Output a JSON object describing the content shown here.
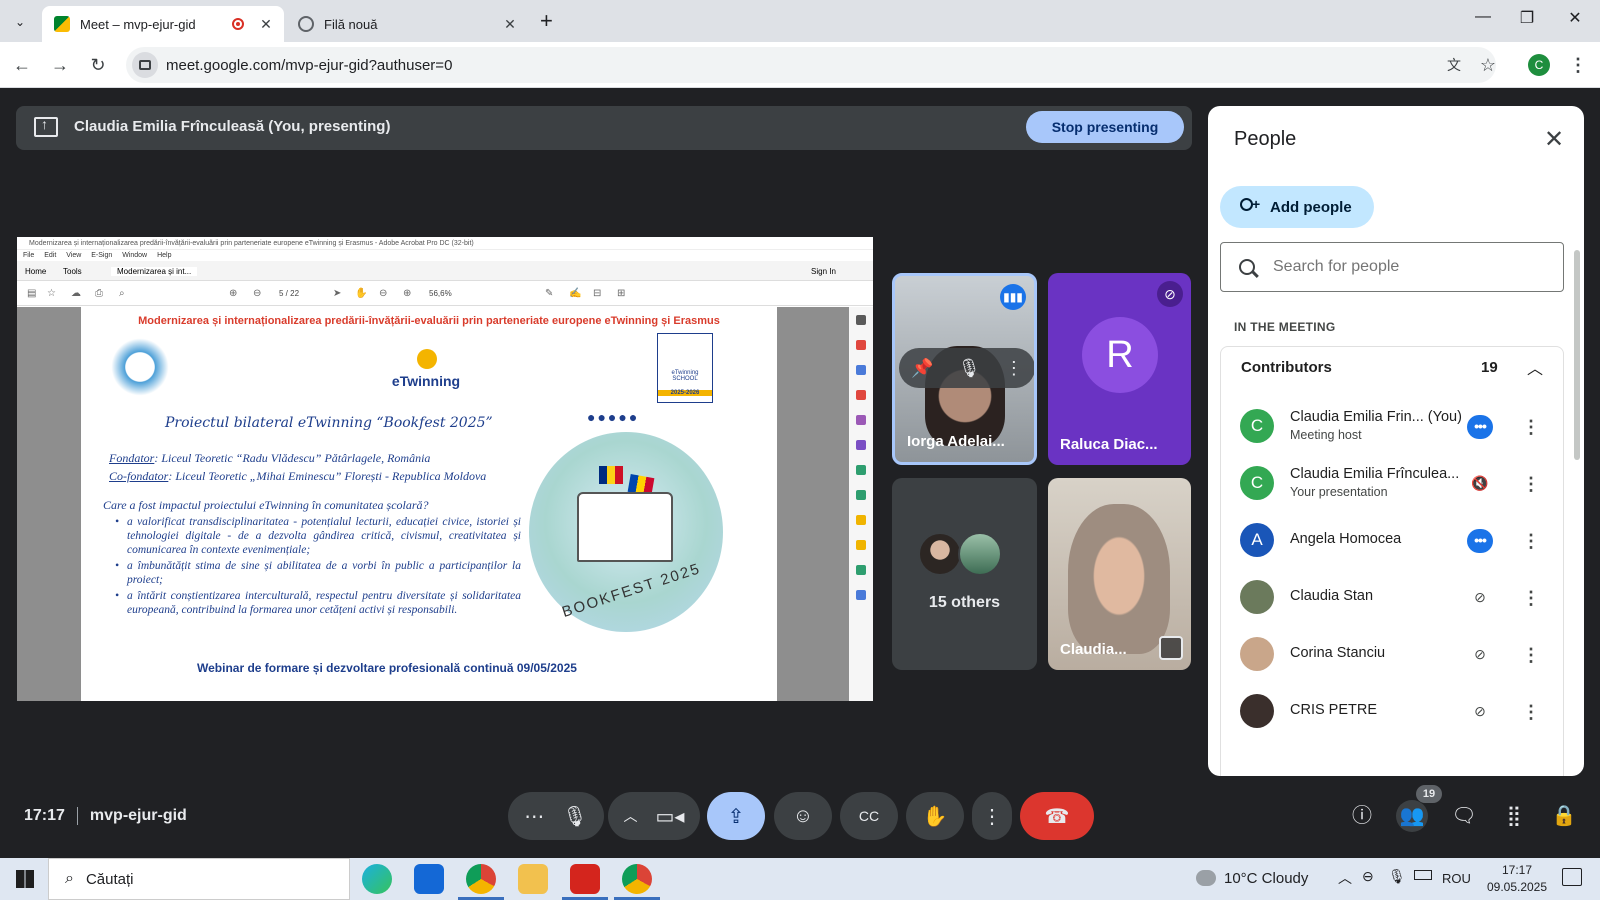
{
  "browser": {
    "tabs": [
      {
        "title": "Meet – mvp-ejur-gid",
        "active": true,
        "recording": true
      },
      {
        "title": "Filă nouă",
        "active": false
      }
    ],
    "new_tab_label": "+",
    "address": "meet.google.com/mvp-ejur-gid?authuser=0",
    "profile_initial": "C"
  },
  "present_bar": {
    "label": "Claudia Emilia Frînculeasă (You, presenting)",
    "stop_label": "Stop presenting"
  },
  "shared_screen": {
    "window_title": "Modernizarea și internaționalizarea predării-învățării-evaluării prin parteneriate europene eTwinning și Erasmus - Adobe Acrobat Pro DC (32-bit)",
    "menu": [
      "File",
      "Edit",
      "View",
      "E-Sign",
      "Window",
      "Help"
    ],
    "tabs": [
      "Home",
      "Tools",
      "Modernizarea și int..."
    ],
    "sign_in": "Sign In",
    "page_indicator": "5 / 22",
    "zoom": "56,6%",
    "slide": {
      "title": "Modernizarea și internaționalizarea predării-învățării-evaluării  prin parteneriate europene  eTwinning și Erasmus",
      "etwinning_logo": "eTwinning",
      "school_badge_line1": "eTwinning",
      "school_badge_line2": "SCHOOL",
      "school_badge_years": "2025-2026",
      "project_title": "Proiectul bilateral eTwinning “Bookfest 2025”",
      "founder_label": "Fondator",
      "founder": ": Liceul Teoretic “Radu Vlădescu” Pătârlagele, România",
      "cofounder_label": "Co-fondator",
      "cofounder": ": Liceul Teoretic „Mihai Eminescu” Florești - Republica Moldova",
      "question": "Care a fost impactul proiectului eTwinning în comunitatea școlară?",
      "bullets": [
        "a valorificat transdisciplinaritatea - potențialul lecturii, educației civice, istoriei și tehnologiei digitale - de a dezvolta gândirea critică, civismul, creativitatea și comunicarea în contexte evenimențiale;",
        "a îmbunătățit stima de sine și abilitatea de a vorbi în public a participanților la proiect;",
        "a întărit conștientizarea interculturală, respectul pentru diversitate și solidaritatea europeană, contribuind la formarea unor cetățeni activi și responsabili."
      ],
      "bookfest_text": "BOOKFEST 2025",
      "footer": "Webinar de formare și dezvoltare profesională continuă 09/05/2025"
    }
  },
  "tiles": [
    {
      "name": "Iorga Adelai..."
    },
    {
      "name": "Raluca Diac...",
      "initial": "R"
    },
    {
      "name": "15 others"
    },
    {
      "name": "Claudia..."
    }
  ],
  "people_panel": {
    "title": "People",
    "add_people": "Add people",
    "search_placeholder": "Search for people",
    "section": "IN THE MEETING",
    "group": "Contributors",
    "count": "19",
    "participants": [
      {
        "initial": "C",
        "name": "Claudia Emilia Frin... (You)",
        "sub": "Meeting host",
        "status": "speaking-dots",
        "color": "#33a853"
      },
      {
        "initial": "C",
        "name": "Claudia Emilia Frînculea...",
        "sub": "Your presentation",
        "status": "audio-muted",
        "color": "#33a853"
      },
      {
        "initial": "A",
        "name": "Angela Homocea",
        "sub": "",
        "status": "speaking-dots",
        "color": "#1a56b8"
      },
      {
        "initial": "",
        "name": "Claudia Stan",
        "sub": "",
        "status": "mic-off",
        "color": "#6b7a5c"
      },
      {
        "initial": "",
        "name": "Corina Stanciu",
        "sub": "",
        "status": "mic-off",
        "color": "#c9a68a"
      },
      {
        "initial": "",
        "name": "CRIS PETRE",
        "sub": "",
        "status": "mic-off",
        "color": "#3a2f2c"
      }
    ]
  },
  "meeting_bar": {
    "time": "17:17",
    "code": "mvp-ejur-gid",
    "people_badge": "19"
  },
  "taskbar": {
    "search_placeholder": "Căutați",
    "weather": "10°C  Cloudy",
    "language": "ROU",
    "clock_time": "17:17",
    "clock_date": "09.05.2025"
  }
}
